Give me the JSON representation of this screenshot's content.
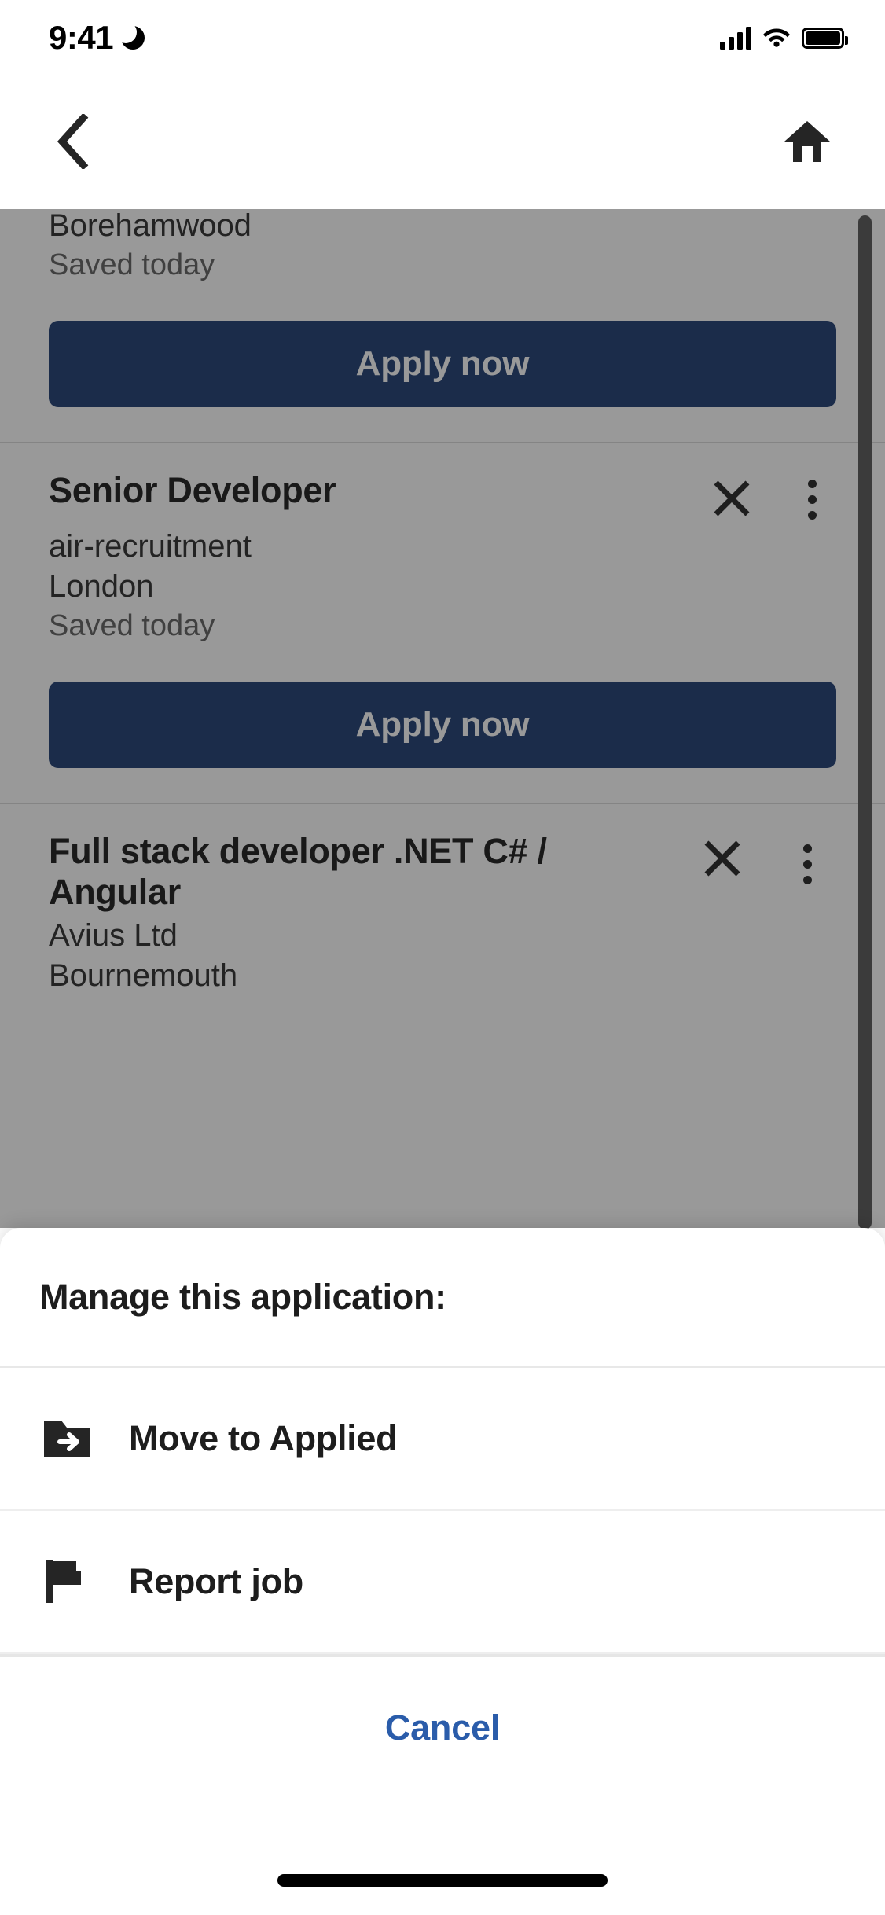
{
  "status_bar": {
    "time": "9:41",
    "dnd_icon": "crescent-moon-icon",
    "signal_icon": "cellular-signal-icon",
    "wifi_icon": "wifi-icon",
    "battery_icon": "battery-full-icon"
  },
  "nav_bar": {
    "back_icon": "chevron-left-icon",
    "home_icon": "home-icon"
  },
  "job_list": {
    "cards": [
      {
        "title": "",
        "company": "",
        "location": "Borehamwood",
        "saved": "Saved today",
        "apply_label": "Apply now",
        "partially_visible": true
      },
      {
        "title": "Senior Developer",
        "company": "air-recruitment",
        "location": "London",
        "saved": "Saved today",
        "apply_label": "Apply now",
        "close_icon": "close-icon",
        "menu_icon": "more-vertical-icon"
      },
      {
        "title": "Full stack developer .NET C# / Angular",
        "company": "Avius Ltd",
        "location": "Bournemouth",
        "close_icon": "close-icon",
        "menu_icon": "more-vertical-icon",
        "menu_focused": true
      }
    ]
  },
  "action_sheet": {
    "title": "Manage this application:",
    "items": [
      {
        "label": "Move to Applied",
        "icon": "folder-move-icon"
      },
      {
        "label": "Report job",
        "icon": "flag-icon"
      }
    ],
    "cancel_label": "Cancel"
  },
  "colors": {
    "apply_button": "#2d4a7c",
    "cancel_text": "#2a5caa",
    "scrim": "rgba(0,0,0,0.40)",
    "sheet_background": "#ffffff"
  }
}
